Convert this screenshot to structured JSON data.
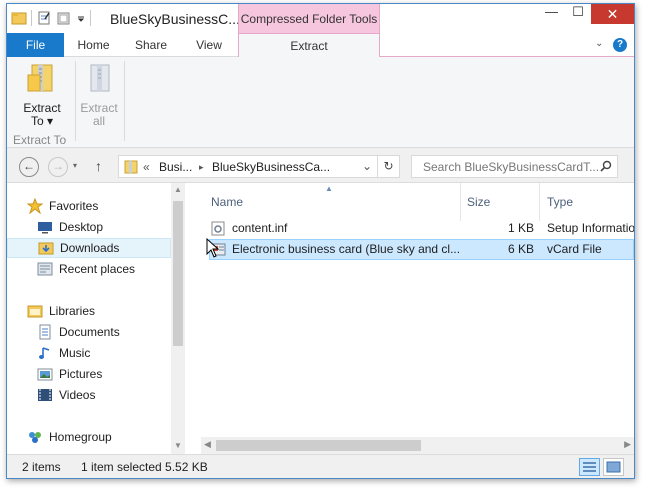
{
  "window": {
    "title": "BlueSkyBusinessC...",
    "context_tab_group": "Compressed Folder Tools",
    "minimize": "—",
    "maximize": "☐",
    "close": "✕"
  },
  "ribbon_tabs": {
    "file": "File",
    "home": "Home",
    "share": "Share",
    "view": "View",
    "extract": "Extract",
    "collapse": "⌄",
    "help": "?"
  },
  "ribbon": {
    "extract_to_line1": "Extract",
    "extract_to_line2": "To ▾",
    "extract_all_line1": "Extract",
    "extract_all_line2": "all",
    "group_label": "Extract To"
  },
  "address": {
    "breadcrumb_sep": "«",
    "crumb1": "Busi...",
    "crumb_arrow": "▸",
    "crumb2": "BlueSkyBusinessCa...",
    "dropdown": "⌄",
    "search_placeholder": "Search BlueSkyBusinessCardT..."
  },
  "nav_pane": {
    "favorites": "Favorites",
    "desktop": "Desktop",
    "downloads": "Downloads",
    "recent_places": "Recent places",
    "libraries": "Libraries",
    "documents": "Documents",
    "music": "Music",
    "pictures": "Pictures",
    "videos": "Videos",
    "homegroup": "Homegroup"
  },
  "columns": {
    "name": "Name",
    "size": "Size",
    "type": "Type"
  },
  "files": [
    {
      "name": "content.inf",
      "size": "1 KB",
      "type": "Setup Informatio"
    },
    {
      "name": "Electronic business card (Blue sky and cl...",
      "size": "6 KB",
      "type": "vCard File"
    }
  ],
  "status": {
    "item_count": "2 items",
    "selection": "1 item selected  5.52 KB"
  },
  "colors": {
    "accent": "#1979ca",
    "context_tab": "#f6c6de",
    "selection": "#cce8ff",
    "close_button": "#c7392f"
  }
}
